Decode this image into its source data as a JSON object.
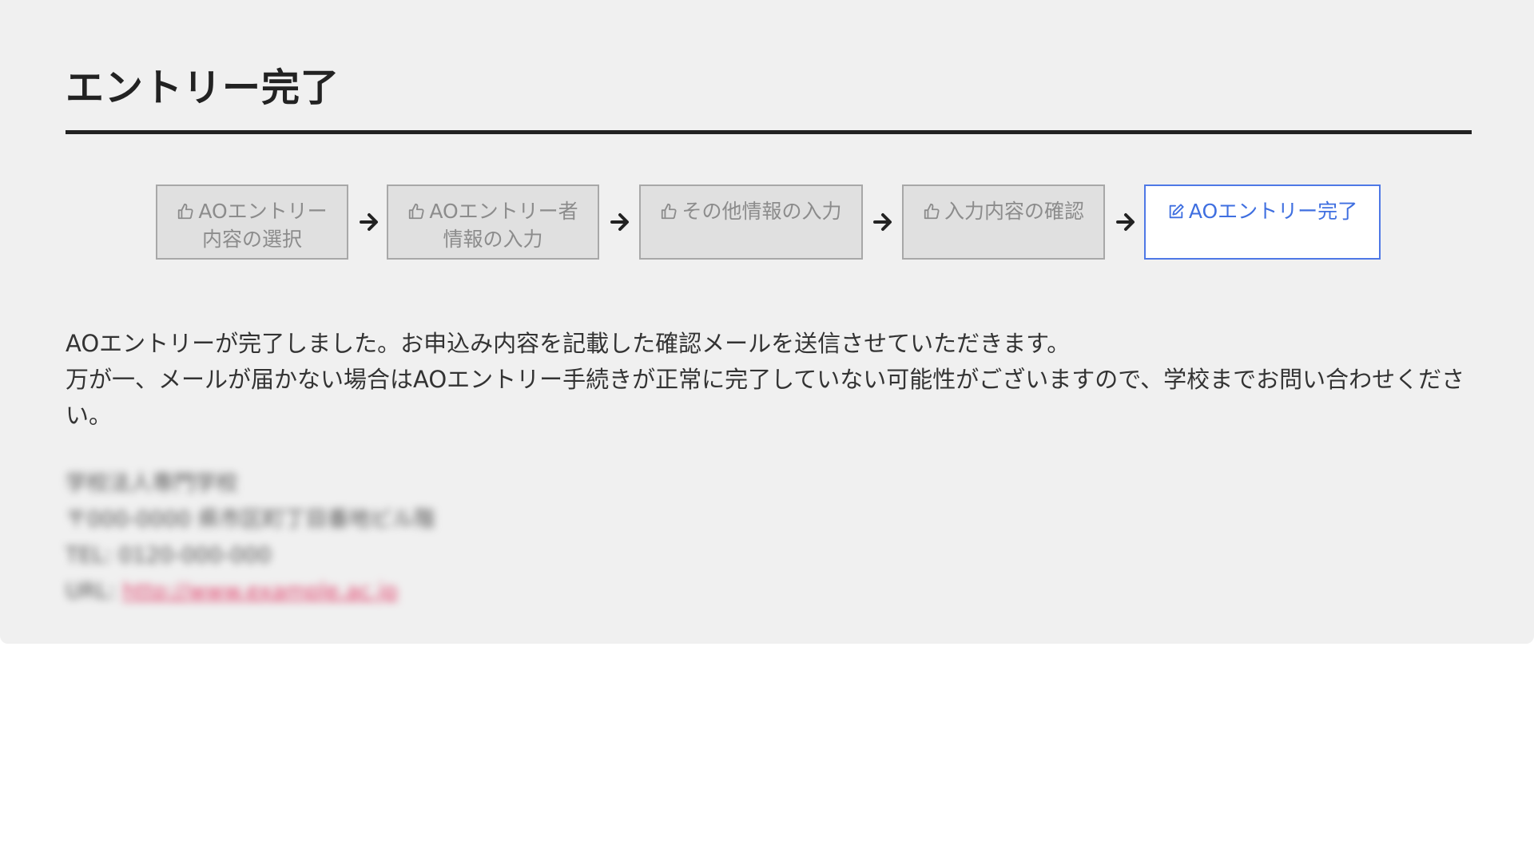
{
  "page": {
    "title": "エントリー完了"
  },
  "steps": [
    {
      "line1": "AOエントリー",
      "line2": "内容の選択",
      "icon": "thumbs-up-icon",
      "active": false
    },
    {
      "line1": "AOエントリー者",
      "line2": "情報の入力",
      "icon": "thumbs-up-icon",
      "active": false
    },
    {
      "line1": "その他情報の入力",
      "line2": "",
      "icon": "thumbs-up-icon",
      "active": false
    },
    {
      "line1": "入力内容の確認",
      "line2": "",
      "icon": "thumbs-up-icon",
      "active": false
    },
    {
      "line1": "AOエントリー完了",
      "line2": "",
      "icon": "edit-icon",
      "active": true
    }
  ],
  "message": {
    "line1": "AOエントリーが完了しました。お申込み内容を記載した確認メールを送信させていただきます。",
    "line2": "万が一、メールが届かない場合はAOエントリー手続きが正常に完了していない可能性がございますので、学校までお問い合わせください。"
  },
  "contact": {
    "school_name": "学校法人専門学校",
    "address": "〒000-0000 県市区町丁目番地ビル階",
    "tel": "TEL: 0120-000-000",
    "url_label": "URL:",
    "url": "http://www.example.ac.jp"
  },
  "colors": {
    "panel_bg": "#f0f0f0",
    "step_inactive_bg": "#e0e0e0",
    "step_active_border": "#4e78e6",
    "link": "#e0406a"
  }
}
